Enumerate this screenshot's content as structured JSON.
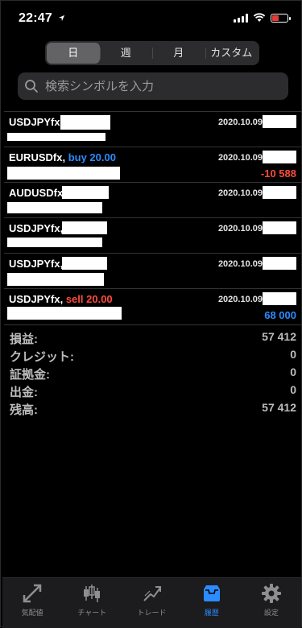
{
  "status": {
    "time": "22:47"
  },
  "segments": [
    "日",
    "週",
    "月",
    "カスタム"
  ],
  "search": {
    "placeholder": "検索シンボルを入力"
  },
  "rows": [
    {
      "symbol": "USDJPYfx,",
      "action": "",
      "date": "2020.10.09",
      "profit": ""
    },
    {
      "symbol": "EURUSDfx,",
      "action": "buy 20.00",
      "date": "2020.10.09",
      "profit": "-10 588"
    },
    {
      "symbol": "AUDUSDfx,",
      "action": "",
      "date": "2020.10.09",
      "profit": ""
    },
    {
      "symbol": "USDJPYfx,",
      "action": "",
      "date": "2020.10.09",
      "profit": ""
    },
    {
      "symbol": "USDJPYfx,",
      "action": "",
      "date": "2020.10.09",
      "profit": ""
    },
    {
      "symbol": "USDJPYfx,",
      "action": "sell 20.00",
      "date": "2020.10.09",
      "profit": "68 000"
    }
  ],
  "summary": [
    {
      "label": "損益:",
      "value": "57 412"
    },
    {
      "label": "クレジット:",
      "value": "0"
    },
    {
      "label": "証拠金:",
      "value": "0"
    },
    {
      "label": "出金:",
      "value": "0"
    },
    {
      "label": "残高:",
      "value": "57 412"
    }
  ],
  "tabs": [
    {
      "label": "気配値",
      "icon": "quotes-icon"
    },
    {
      "label": "チャート",
      "icon": "chart-icon"
    },
    {
      "label": "トレード",
      "icon": "trade-icon"
    },
    {
      "label": "履歴",
      "icon": "history-icon"
    },
    {
      "label": "設定",
      "icon": "settings-icon"
    }
  ],
  "colors": {
    "buy": "#2a8cff",
    "sell": "#ff4a3a",
    "active_tab": "#2a8cff"
  }
}
